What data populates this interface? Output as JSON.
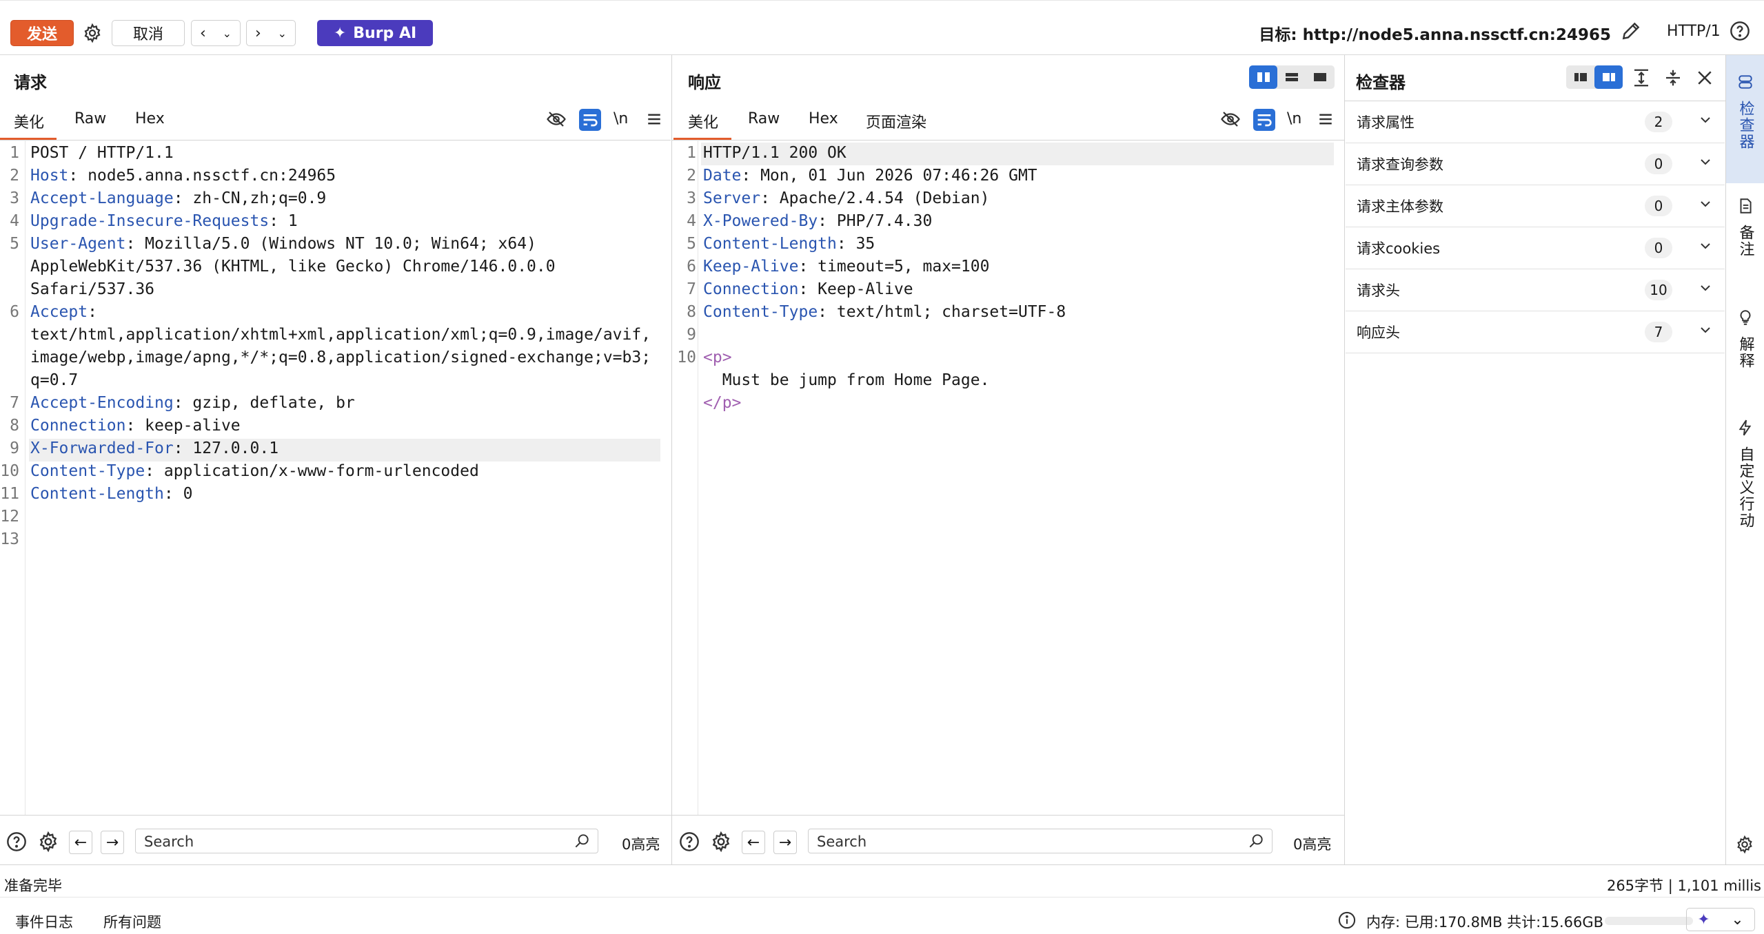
{
  "toolbar": {
    "send": "发送",
    "cancel": "取消",
    "burp_ai": "Burp AI",
    "target_label": "目标: http://node5.anna.nssctf.cn:24965",
    "http_version": "HTTP/1"
  },
  "request": {
    "title": "请求",
    "tabs": [
      "美化",
      "Raw",
      "Hex"
    ],
    "newline_label": "\\n",
    "lines": [
      {
        "n": "1",
        "k": "",
        "v": "POST / HTTP/1.1"
      },
      {
        "n": "2",
        "k": "Host",
        "v": ": node5.anna.nssctf.cn:24965"
      },
      {
        "n": "3",
        "k": "Accept-Language",
        "v": ": zh-CN,zh;q=0.9"
      },
      {
        "n": "4",
        "k": "Upgrade-Insecure-Requests",
        "v": ": 1"
      },
      {
        "n": "5",
        "k": "User-Agent",
        "v": ": Mozilla/5.0 (Windows NT 10.0; Win64; x64)"
      },
      {
        "n": "",
        "k": "",
        "v": "AppleWebKit/537.36 (KHTML, like Gecko) Chrome/146.0.0.0"
      },
      {
        "n": "",
        "k": "",
        "v": "Safari/537.36"
      },
      {
        "n": "6",
        "k": "Accept",
        "v": ":"
      },
      {
        "n": "",
        "k": "",
        "v": "text/html,application/xhtml+xml,application/xml;q=0.9,image/avif,"
      },
      {
        "n": "",
        "k": "",
        "v": "image/webp,image/apng,*/*;q=0.8,application/signed-exchange;v=b3;"
      },
      {
        "n": "",
        "k": "",
        "v": "q=0.7"
      },
      {
        "n": "7",
        "k": "Accept-Encoding",
        "v": ": gzip, deflate, br"
      },
      {
        "n": "8",
        "k": "Connection",
        "v": ": keep-alive"
      },
      {
        "n": "9",
        "k": "X-Forwarded-For",
        "v": ": 127.0.0.1"
      },
      {
        "n": "10",
        "k": "Content-Type",
        "v": ": application/x-www-form-urlencoded"
      },
      {
        "n": "11",
        "k": "Content-Length",
        "v": ": 0"
      },
      {
        "n": "12",
        "k": "",
        "v": ""
      },
      {
        "n": "13",
        "k": "",
        "v": ""
      }
    ],
    "search_placeholder": "Search",
    "highlights": "0高亮"
  },
  "response": {
    "title": "响应",
    "tabs": [
      "美化",
      "Raw",
      "Hex",
      "页面渲染"
    ],
    "newline_label": "\\n",
    "lines": [
      {
        "n": "1",
        "k": "",
        "v": "HTTP/1.1 200 OK"
      },
      {
        "n": "2",
        "k": "Date",
        "v": ": Mon, 01 Jun 2026 07:46:26 GMT"
      },
      {
        "n": "3",
        "k": "Server",
        "v": ": Apache/2.4.54 (Debian)"
      },
      {
        "n": "4",
        "k": "X-Powered-By",
        "v": ": PHP/7.4.30"
      },
      {
        "n": "5",
        "k": "Content-Length",
        "v": ": 35"
      },
      {
        "n": "6",
        "k": "Keep-Alive",
        "v": ": timeout=5, max=100"
      },
      {
        "n": "7",
        "k": "Connection",
        "v": ": Keep-Alive"
      },
      {
        "n": "8",
        "k": "Content-Type",
        "v": ": text/html; charset=UTF-8"
      },
      {
        "n": "9",
        "k": "",
        "v": ""
      },
      {
        "n": "10",
        "k": "",
        "v": "",
        "tag": "<p>"
      },
      {
        "n": "",
        "k": "",
        "v": "  Must be jump from Home Page."
      },
      {
        "n": "",
        "k": "",
        "v": "",
        "tag": "</p>"
      }
    ],
    "search_placeholder": "Search",
    "highlights": "0高亮"
  },
  "inspector": {
    "title": "检查器",
    "rows": [
      {
        "label": "请求属性",
        "count": "2"
      },
      {
        "label": "请求查询参数",
        "count": "0"
      },
      {
        "label": "请求主体参数",
        "count": "0"
      },
      {
        "label": "请求cookies",
        "count": "0"
      },
      {
        "label": "请求头",
        "count": "10"
      },
      {
        "label": "响应头",
        "count": "7"
      }
    ]
  },
  "side_tabs": [
    "检查器",
    "备注",
    "解释",
    "自定义行动"
  ],
  "status": {
    "ready": "准备完毕",
    "stats": "265字节 | 1,101 millis",
    "event_log": "事件日志",
    "all_issues": "所有问题",
    "memory": "内存: 已用:170.8MB 共计:15.66GB"
  },
  "colors": {
    "accent": "#e35c2c",
    "ai": "#4b3bbd",
    "key": "#2a55b0",
    "tag": "#a05fb0",
    "active_blue": "#2a6fd6"
  }
}
